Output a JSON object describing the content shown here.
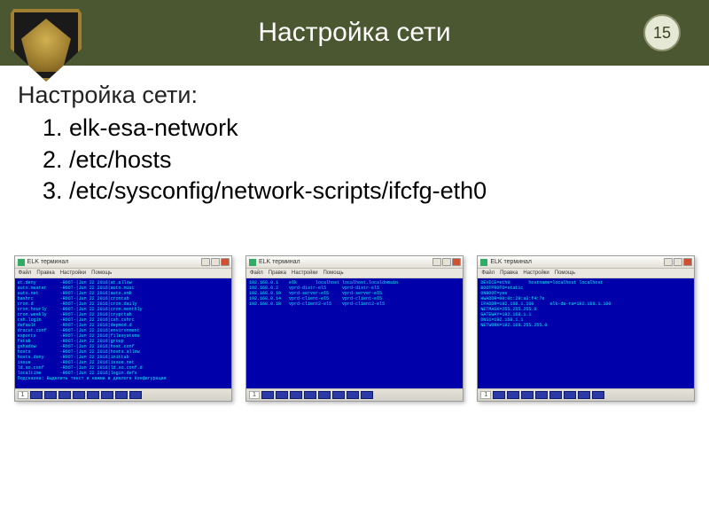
{
  "header": {
    "title": "Настройка сети",
    "page_number": "15"
  },
  "body": {
    "heading": "Настройка сети:",
    "items": [
      "elk-esa-network",
      "/etc/hosts",
      "/etc/sysconfig/network-scripts/ifcfg-eth0"
    ]
  },
  "screenshots": [
    {
      "window_title": "ELK терминал",
      "menu": [
        "Файл",
        "Правка",
        "Настройки",
        "Помощь"
      ],
      "page_label": "1",
      "terminal_text": "at.deny         -ROOT-|Jun 22 2016|at.allow\nauto.master     -ROOT-|Jun 22 2016|auto.misc\nauto.net        -ROOT-|Jun 22 2016|auto.smb\nbashrc          -ROOT-|Jun 22 2016|crontab\ncron.d          -ROOT-|Jun 22 2016|cron.daily\ncron.hourly     -ROOT-|Jun 22 2016|cron.monthly\ncron.weekly     -ROOT-|Jun 22 2016|crypttab\ncsh.login       -ROOT-|Jun 22 2016|csh.cshrc\ndefault         -ROOT-|Jun 22 2016|depmod.d\ndracut.conf     -ROOT-|Jun 22 2016|environment\nexports         -ROOT-|Jun 22 2016|filesystems\nfstab           -ROOT-|Jun 22 2016|group\ngshadow         -ROOT-|Jun 22 2016|host.conf\nhosts           -ROOT-|Jun 22 2016|hosts.allow\nhosts.deny      -ROOT-|Jun 22 2016|inittab\nissue           -ROOT-|Jun 22 2016|issue.net\nld.so.conf      -ROOT-|Jun 22 2016|ld.so.conf.d\nlocaltime       -ROOT-|Jun 22 2016|login.defs\nПодсказка: Выделить текст и нажми в диалоге Конфигурация"
    },
    {
      "window_title": "ELK терминал",
      "menu": [
        "Файл",
        "Правка",
        "Настройки",
        "Помощь"
      ],
      "page_label": "1",
      "terminal_text": "192.168.0.1    elk       localhost localhost.localdomain\n192.168.0.2    vprd-distr-el5      vprd-distr-el5\n192.168.0.10   vprd-server-el5     vprd-server-el5\n192.168.0.14   vprd-client-el5     vprd-client-el5\n192.168.0.18   vprd-client2-el5    vprd-client2-el5"
    },
    {
      "window_title": "ELK терминал",
      "menu": [
        "Файл",
        "Правка",
        "Настройки",
        "Помощь"
      ],
      "page_label": "1",
      "terminal_text": "DEVICE=eth0       hostname=localhost localhost\nBOOTPROTO=static\nONBOOT=yes\nHWADDR=00:0c:29:a3:f4:7e\nIPADDR=192.168.1.100      elk-da-ra=192.168.1.100\nNETMASK=255.255.255.0\nGATEWAY=192.168.1.1\nDNS1=192.168.1.1\nNETWORK=192.168.255.255.0"
    }
  ]
}
